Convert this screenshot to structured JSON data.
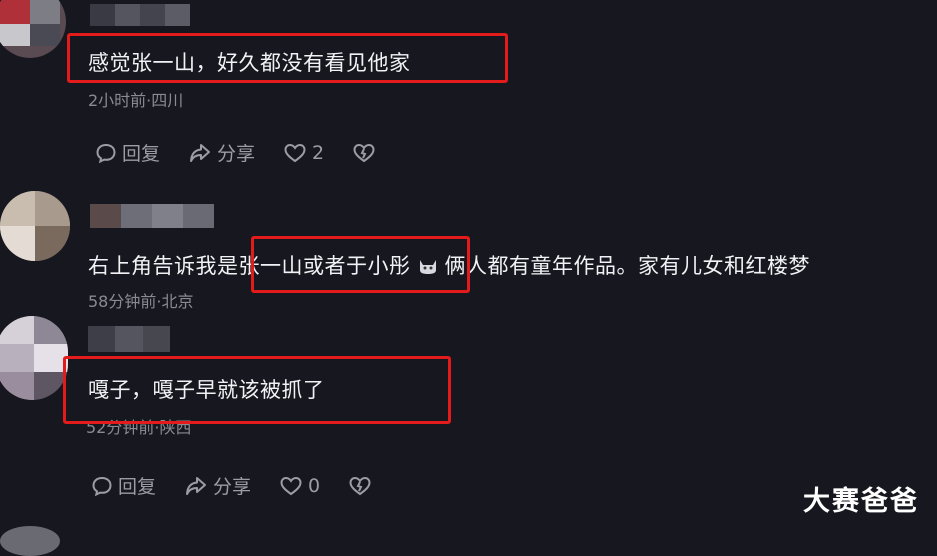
{
  "comments": [
    {
      "text": "感觉张一山，好久都没有看见他家",
      "meta": "2小时前·四川",
      "reply_label": "回复",
      "share_label": "分享",
      "like_count": "2"
    },
    {
      "text_a": "右上角告诉我是",
      "text_b": "张一山或者于小彤",
      "text_c": "俩人都有童年作品。家有儿女和红楼梦",
      "meta": "58分钟前·北京"
    },
    {
      "text": "嘎子，嘎子早就该被抓了",
      "meta": "52分钟前·陕西",
      "reply_label": "回复",
      "share_label": "分享",
      "like_count": "0"
    }
  ],
  "watermark": "大赛爸爸",
  "colors": {
    "background": "#17171f",
    "highlight_box": "#e31b1b",
    "meta_text": "#8a8a95",
    "action_text": "#9c9ca6"
  },
  "icons": [
    "reply-icon",
    "share-icon",
    "heart-icon",
    "dislike-heart-icon",
    "cat-emoji-icon"
  ]
}
